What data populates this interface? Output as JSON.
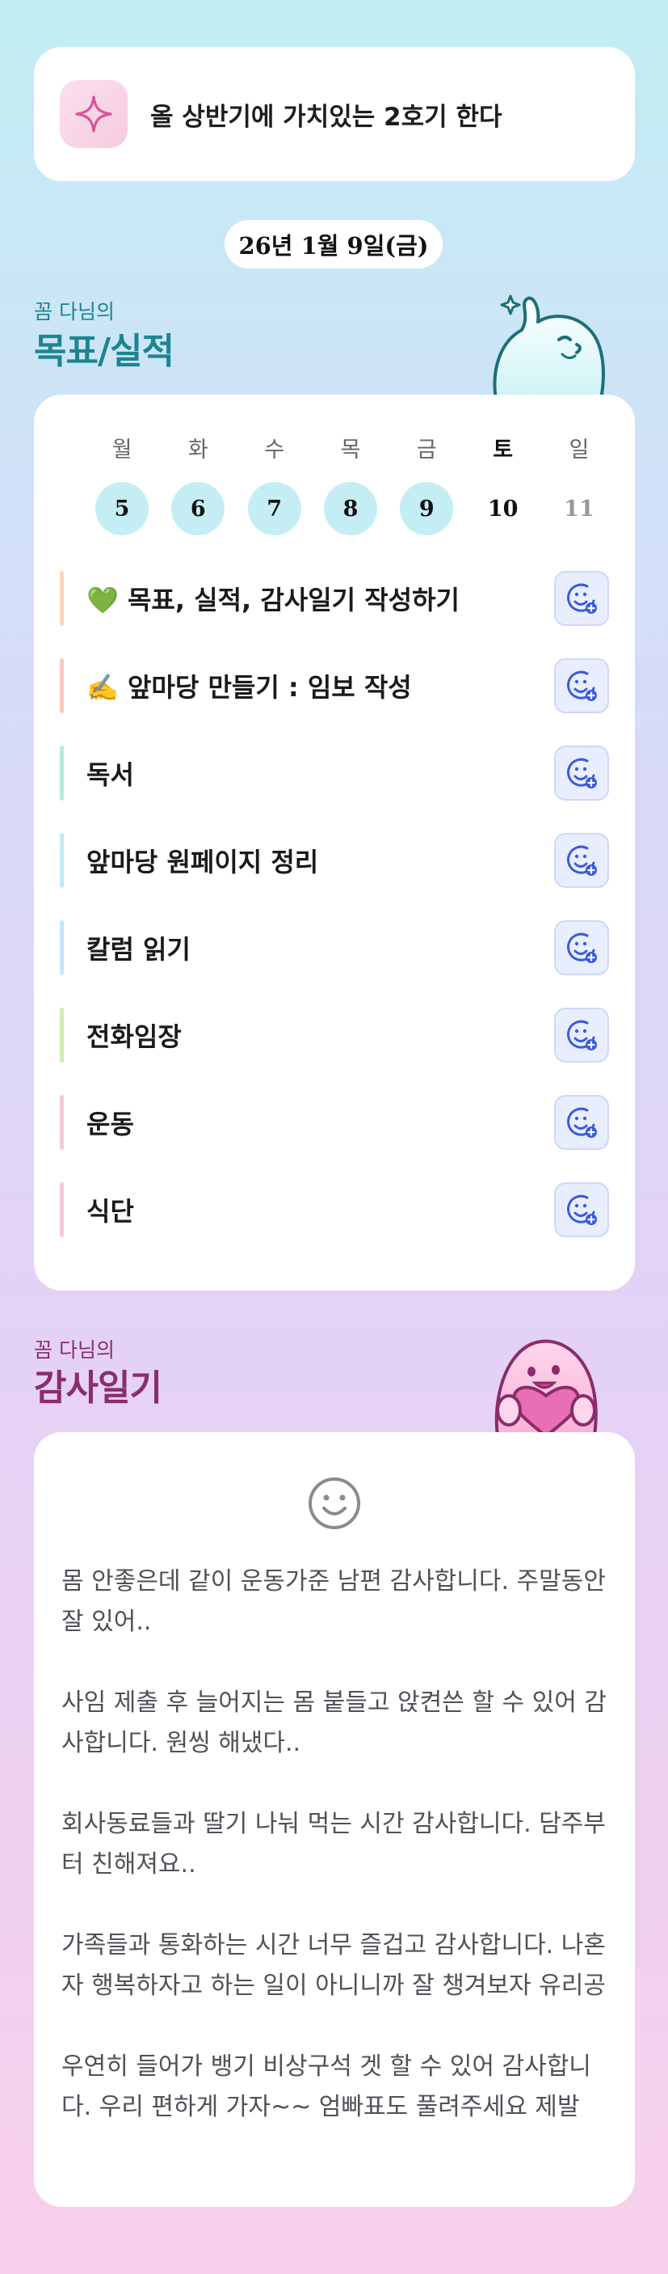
{
  "goal_banner": {
    "icon": "sparkle-icon",
    "text": "올 상반기에 가치있는 2호기 한다"
  },
  "date": "26년 1월 9일(금)",
  "goals_section": {
    "subtitle": "꼼 다님의",
    "title": "목표/실적"
  },
  "week": {
    "weekdays": [
      "월",
      "화",
      "수",
      "목",
      "금",
      "토",
      "일"
    ],
    "days": [
      "5",
      "6",
      "7",
      "8",
      "9",
      "10",
      "11"
    ],
    "completed_days": [
      "5",
      "6",
      "7",
      "8",
      "9"
    ]
  },
  "tasks": [
    {
      "label": "💚 목표, 실적, 감사일기 작성하기",
      "bar_color": "#f9d6b8"
    },
    {
      "label": "✍️ 앞마당 만들기 : 임보 작성",
      "bar_color": "#f9c9c0"
    },
    {
      "label": "독서",
      "bar_color": "#b5ecd9"
    },
    {
      "label": "앞마당 원페이지 정리",
      "bar_color": "#bfeaf5"
    },
    {
      "label": "칼럼 읽기",
      "bar_color": "#c3e7f7"
    },
    {
      "label": "전화임장",
      "bar_color": "#cdeeb2"
    },
    {
      "label": "운동",
      "bar_color": "#f7c8e0"
    },
    {
      "label": "식단",
      "bar_color": "#f9c7dc"
    }
  ],
  "gratitude_section": {
    "subtitle": "꼼 다님의",
    "title": "감사일기",
    "icon": "smile-icon",
    "entries": [
      "몸 안좋은데 같이 운동가준 남편 감사합니다. 주말동안 잘 있어..",
      "사임 제출 후 늘어지는 몸 붙들고 앉켠쓴 할 수 있어 감사합니다. 원씽 해냈다..",
      "회사동료들과 딸기 나눠 먹는 시간 감사합니다. 담주부터 친해져요..",
      "가족들과 통화하는 시간 너무 즐겁고 감사합니다. 나혼자 행복하자고 하는 일이 아니니까 잘 챙겨보자 유리공",
      "우연히 들어가 뱅기 비상구석 겟 할 수 있어 감사합니다. 우리 편하게 가자~~ 엄빠표도 풀려주세요 제발"
    ]
  },
  "colors": {
    "accent_teal": "#1d8492",
    "accent_plum": "#8a2d6a",
    "day_done_bg": "#c5eef4",
    "task_button_bg": "#e8eefe"
  }
}
